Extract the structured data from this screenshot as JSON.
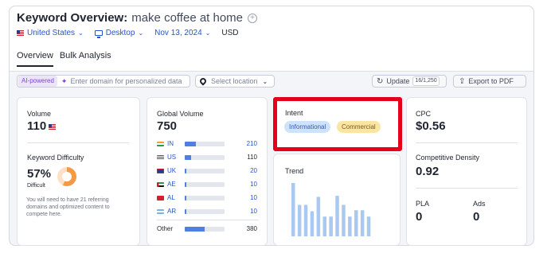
{
  "header": {
    "title": "Keyword Overview:",
    "keyword": "make coffee at home",
    "filters": {
      "country": "United States",
      "device": "Desktop",
      "date": "Nov 13, 2024",
      "currency": "USD"
    },
    "tabs": [
      {
        "label": "Overview",
        "active": true
      },
      {
        "label": "Bulk Analysis",
        "active": false
      }
    ]
  },
  "toolbar": {
    "ai_badge": "AI-powered",
    "domain_placeholder": "Enter domain for personalized data",
    "location_placeholder": "Select location",
    "update_label": "Update",
    "update_quota": "16/1,250",
    "export_label": "Export to PDF"
  },
  "volume": {
    "label": "Volume",
    "value": "110"
  },
  "keyword_difficulty": {
    "label": "Keyword Difficulty",
    "value": "57%",
    "level": "Difficult",
    "percent": 57,
    "note": "You will need to have 21 referring domains and optimized content to compete here."
  },
  "global_volume": {
    "label": "Global Volume",
    "value": "750",
    "rows": [
      {
        "code": "IN",
        "value": "210",
        "share": 0.28
      },
      {
        "code": "US",
        "value": "110",
        "share": 0.15
      },
      {
        "code": "UK",
        "value": "20",
        "share": 0.03
      },
      {
        "code": "AE",
        "value": "10",
        "share": 0.02
      },
      {
        "code": "AL",
        "value": "10",
        "share": 0.02
      },
      {
        "code": "AR",
        "value": "10",
        "share": 0.02
      }
    ],
    "other": {
      "label": "Other",
      "value": "380",
      "share": 0.5
    }
  },
  "intent": {
    "label": "Intent",
    "badges": [
      "Informational",
      "Commercial"
    ]
  },
  "trend": {
    "label": "Trend",
    "values": [
      1.0,
      0.59,
      0.59,
      0.47,
      0.74,
      0.37,
      0.37,
      0.76,
      0.59,
      0.37,
      0.49,
      0.49,
      0.37
    ],
    "color": "#a9c9f1"
  },
  "cpc": {
    "label": "CPC",
    "value": "$0.56"
  },
  "competitive_density": {
    "label": "Competitive Density",
    "value": "0.92"
  },
  "pla": {
    "label": "PLA",
    "value": "0"
  },
  "ads": {
    "label": "Ads",
    "value": "0"
  },
  "colors": {
    "accent_blue": "#2454cc",
    "highlight_red": "#e5001b",
    "bar_blue": "#4f7fe0"
  }
}
